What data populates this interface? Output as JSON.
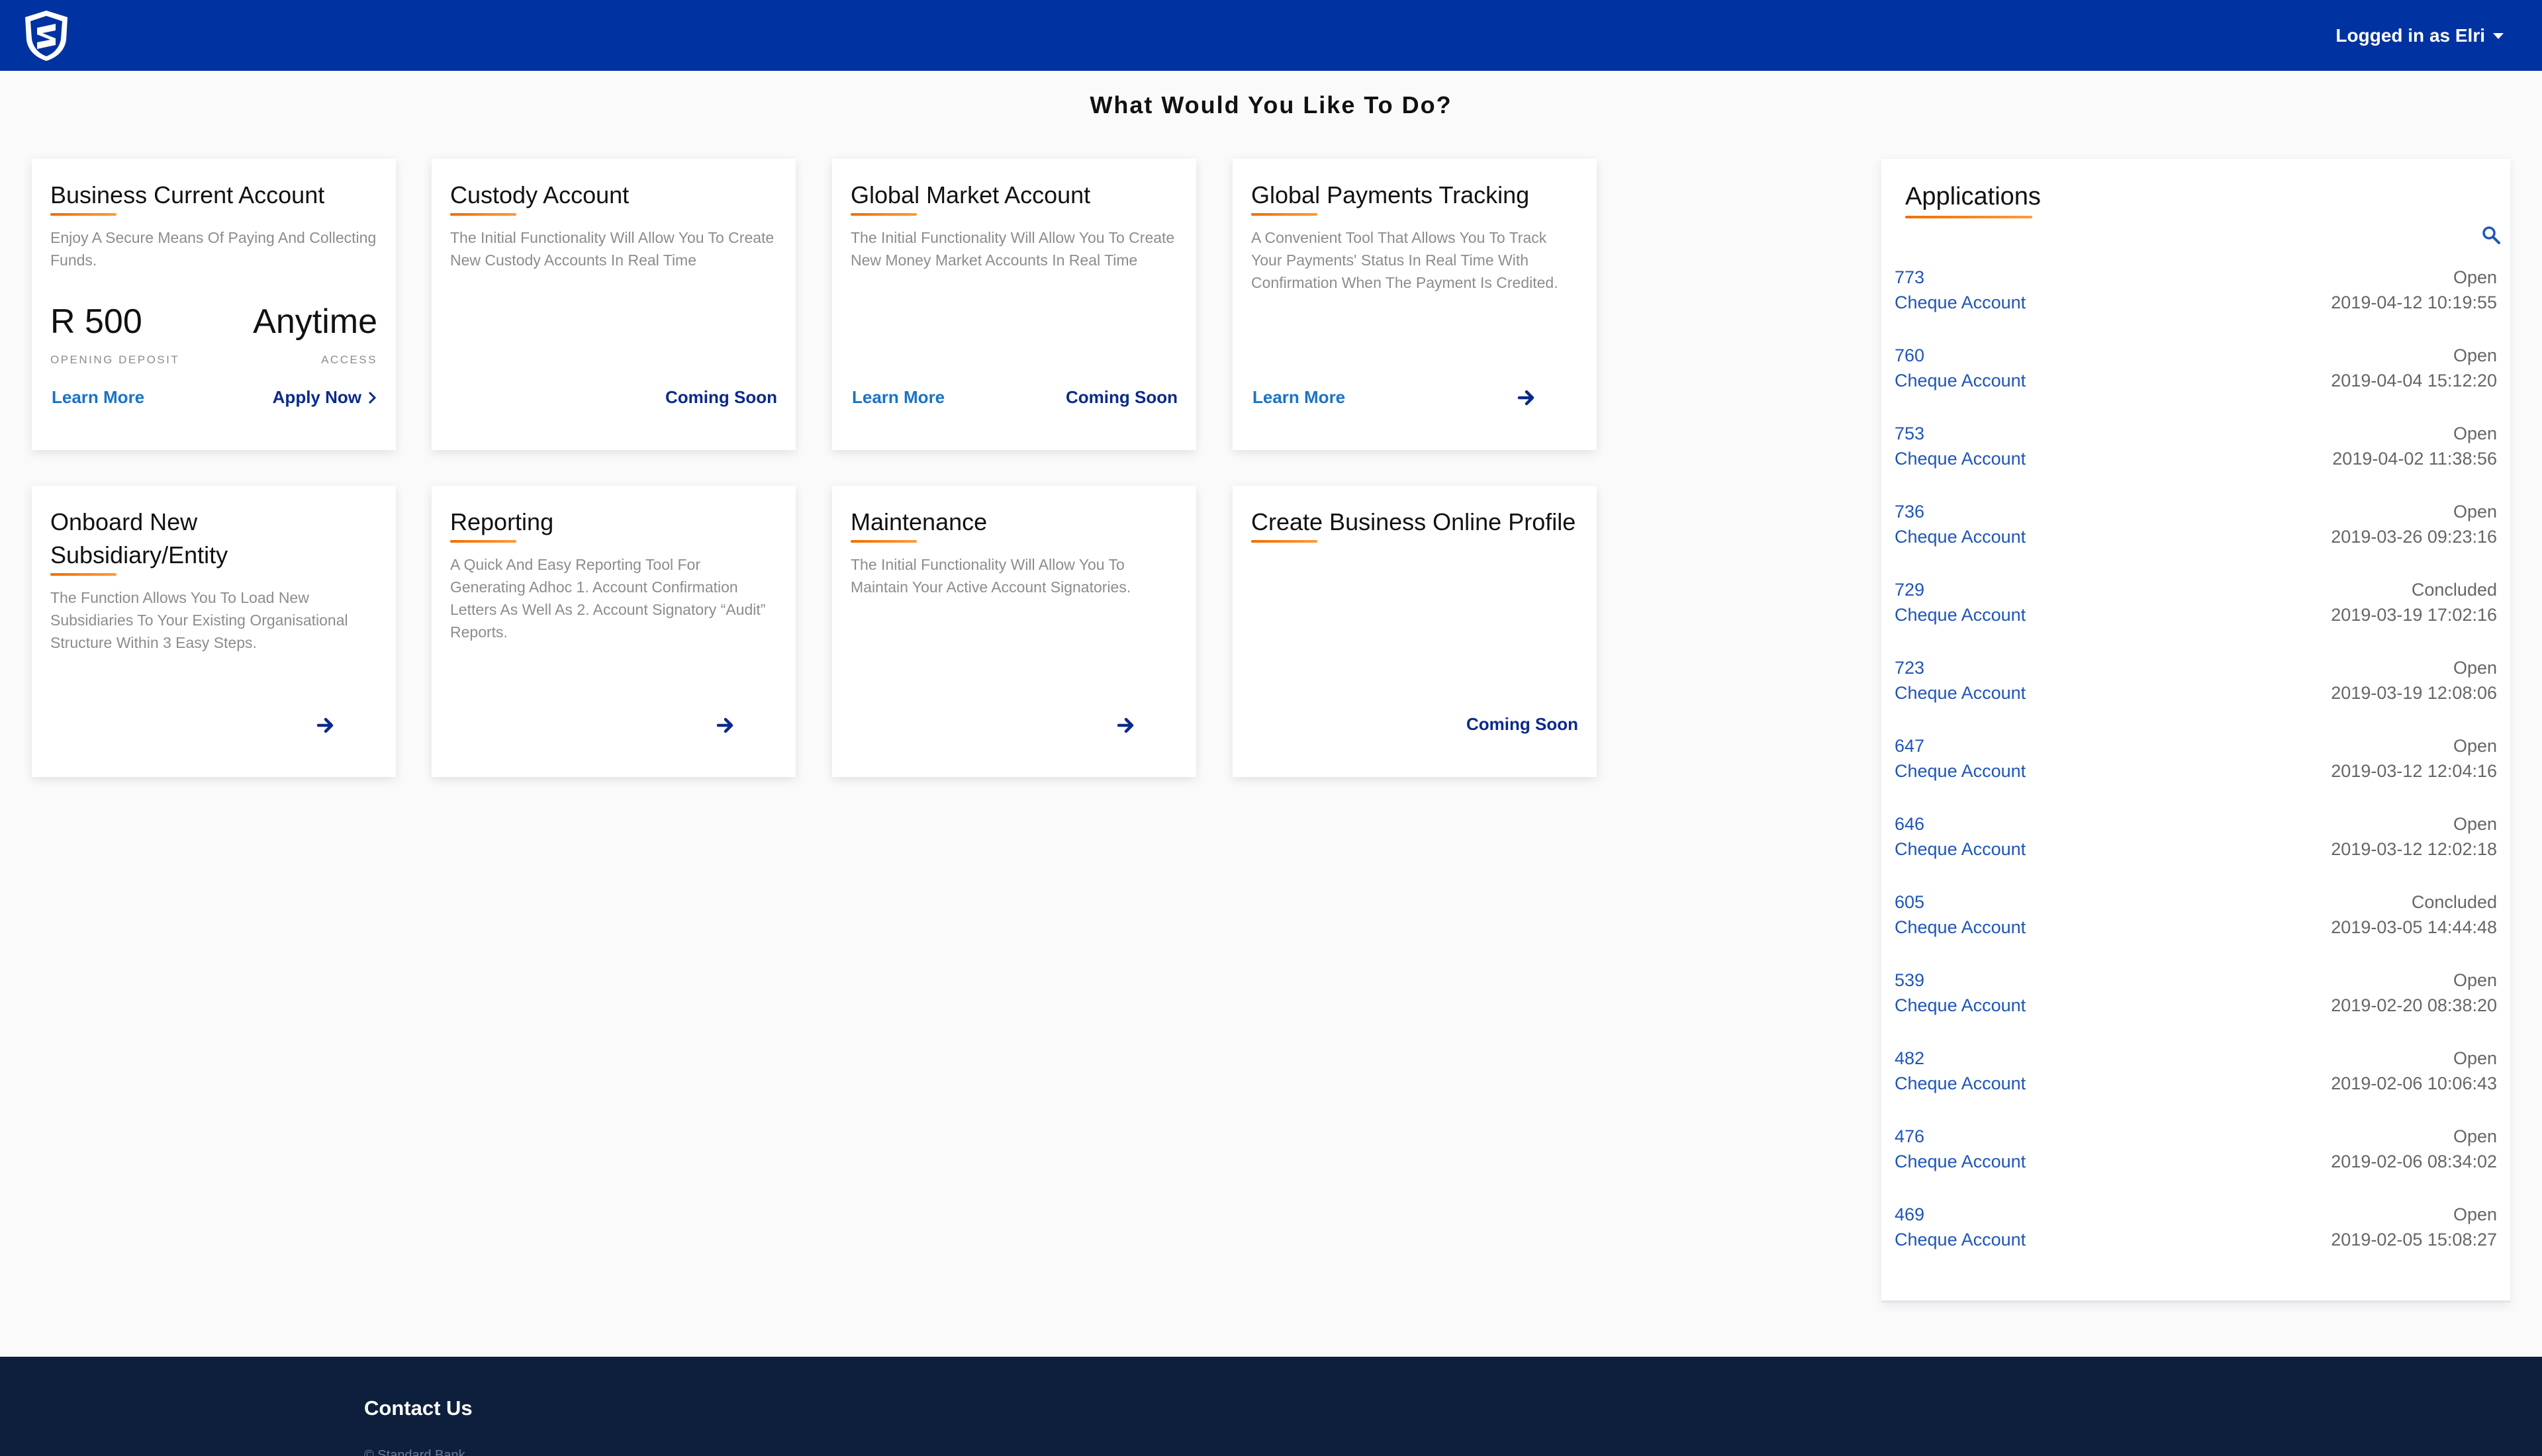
{
  "header": {
    "user_label": "Logged in as Elri"
  },
  "page_title": "What Would You Like To Do?",
  "cards": [
    {
      "title": "Business Current Account",
      "desc": "Enjoy A Secure Means Of Paying And Collecting Funds.",
      "stat1_value": "R 500",
      "stat1_label": "OPENING DEPOSIT",
      "stat2_value": "Anytime",
      "stat2_label": "ACCESS",
      "learn": "Learn More",
      "apply": "Apply Now"
    },
    {
      "title": "Custody Account",
      "desc": "The Initial Functionality Will Allow You To Create New Custody Accounts In Real Time",
      "action": "Coming Soon"
    },
    {
      "title": "Global Market Account",
      "desc": "The Initial Functionality Will Allow You To Create New Money Market Accounts In Real Time",
      "learn": "Learn More",
      "action": "Coming Soon"
    },
    {
      "title": "Global Payments Tracking",
      "desc": "A Convenient Tool That Allows You To Track Your Payments' Status In Real Time With Confirmation When The Payment Is Credited.",
      "learn": "Learn More"
    },
    {
      "title": "Onboard New Subsidiary/Entity",
      "desc": "The Function Allows You To Load New Subsidiaries To Your Existing Organisational Structure Within 3 Easy Steps."
    },
    {
      "title": "Reporting",
      "desc": "A Quick And Easy Reporting Tool For Generating Adhoc 1. Account Confirmation Letters As Well As 2. Account Signatory “Audit” Reports."
    },
    {
      "title": "Maintenance",
      "desc": "The Initial Functionality Will Allow You To Maintain Your Active Account Signatories."
    },
    {
      "title": "Create Business Online Profile",
      "action": "Coming Soon"
    }
  ],
  "applications": {
    "title": "Applications",
    "items": [
      {
        "id": "773",
        "type": "Cheque Account",
        "status": "Open",
        "date": "2019-04-12 10:19:55"
      },
      {
        "id": "760",
        "type": "Cheque Account",
        "status": "Open",
        "date": "2019-04-04 15:12:20"
      },
      {
        "id": "753",
        "type": "Cheque Account",
        "status": "Open",
        "date": "2019-04-02 11:38:56"
      },
      {
        "id": "736",
        "type": "Cheque Account",
        "status": "Open",
        "date": "2019-03-26 09:23:16"
      },
      {
        "id": "729",
        "type": "Cheque Account",
        "status": "Concluded",
        "date": "2019-03-19 17:02:16"
      },
      {
        "id": "723",
        "type": "Cheque Account",
        "status": "Open",
        "date": "2019-03-19 12:08:06"
      },
      {
        "id": "647",
        "type": "Cheque Account",
        "status": "Open",
        "date": "2019-03-12 12:04:16"
      },
      {
        "id": "646",
        "type": "Cheque Account",
        "status": "Open",
        "date": "2019-03-12 12:02:18"
      },
      {
        "id": "605",
        "type": "Cheque Account",
        "status": "Concluded",
        "date": "2019-03-05 14:44:48"
      },
      {
        "id": "539",
        "type": "Cheque Account",
        "status": "Open",
        "date": "2019-02-20 08:38:20"
      },
      {
        "id": "482",
        "type": "Cheque Account",
        "status": "Open",
        "date": "2019-02-06 10:06:43"
      },
      {
        "id": "476",
        "type": "Cheque Account",
        "status": "Open",
        "date": "2019-02-06 08:34:02"
      },
      {
        "id": "469",
        "type": "Cheque Account",
        "status": "Open",
        "date": "2019-02-05 15:08:27"
      }
    ]
  },
  "footer": {
    "title": "Contact Us",
    "copyright": "© Standard Bank"
  },
  "colors": {
    "brand_blue": "#0033a1",
    "accent_orange": "#f06f00",
    "footer_navy": "#0d1f3c",
    "link_blue": "#1f55b8"
  },
  "icons": {
    "logo": "shield-logo-icon",
    "arrow": "arrow-right-icon",
    "chevron": "chevron-right-icon",
    "search": "search-icon",
    "caret": "caret-down-icon"
  }
}
